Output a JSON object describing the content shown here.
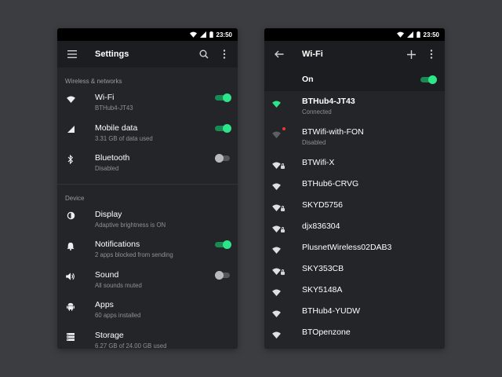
{
  "colors": {
    "accent": "#2ee68a",
    "background": "#242529",
    "appbar": "#1c1d20",
    "page": "#3c3d41",
    "alert": "#e53935"
  },
  "status": {
    "time": "23:50"
  },
  "settings": {
    "title": "Settings",
    "sections": [
      {
        "header": "Wireless & networks",
        "items": [
          {
            "icon": "wifi-icon",
            "title": "Wi-Fi",
            "subtitle": "BTHub4-JT43",
            "toggle": "on"
          },
          {
            "icon": "signal-icon",
            "title": "Mobile data",
            "subtitle": "3.31 GB of data used",
            "toggle": "on"
          },
          {
            "icon": "bluetooth-icon",
            "title": "Bluetooth",
            "subtitle": "Disabled",
            "toggle": "off"
          }
        ]
      },
      {
        "header": "Device",
        "items": [
          {
            "icon": "brightness-icon",
            "title": "Display",
            "subtitle": "Adaptive brightness is ON"
          },
          {
            "icon": "bell-icon",
            "title": "Notifications",
            "subtitle": "2 apps blocked from sending",
            "toggle": "on"
          },
          {
            "icon": "volume-icon",
            "title": "Sound",
            "subtitle": "All sounds muted",
            "toggle": "off"
          },
          {
            "icon": "android-icon",
            "title": "Apps",
            "subtitle": "60 apps installed"
          },
          {
            "icon": "storage-icon",
            "title": "Storage",
            "subtitle": "6.27 GB of 24.00 GB used"
          }
        ]
      }
    ]
  },
  "wifi": {
    "title": "Wi-Fi",
    "master_label": "On",
    "master_toggle": "on",
    "networks": [
      {
        "name": "BTHub4-JT43",
        "status": "Connected",
        "icon": "wifi-full-icon",
        "lock": false,
        "active": true
      },
      {
        "name": "BTWifi-with-FON",
        "status": "Disabled",
        "icon": "wifi-disabled-icon",
        "lock": false,
        "disabled": true
      },
      {
        "name": "BTWifi-X",
        "icon": "wifi-locked-icon",
        "lock": true
      },
      {
        "name": "BTHub6-CRVG",
        "icon": "wifi-icon",
        "lock": false
      },
      {
        "name": "SKYD5756",
        "icon": "wifi-locked-icon",
        "lock": true
      },
      {
        "name": "djx836304",
        "icon": "wifi-locked-icon",
        "lock": true
      },
      {
        "name": "PlusnetWireless02DAB3",
        "icon": "wifi-icon",
        "lock": false
      },
      {
        "name": "SKY353CB",
        "icon": "wifi-locked-icon",
        "lock": true
      },
      {
        "name": "SKY5148A",
        "icon": "wifi-icon",
        "lock": false
      },
      {
        "name": "BTHub4-YUDW",
        "icon": "wifi-icon",
        "lock": false
      },
      {
        "name": "BTOpenzone",
        "icon": "wifi-icon",
        "lock": false
      }
    ]
  }
}
